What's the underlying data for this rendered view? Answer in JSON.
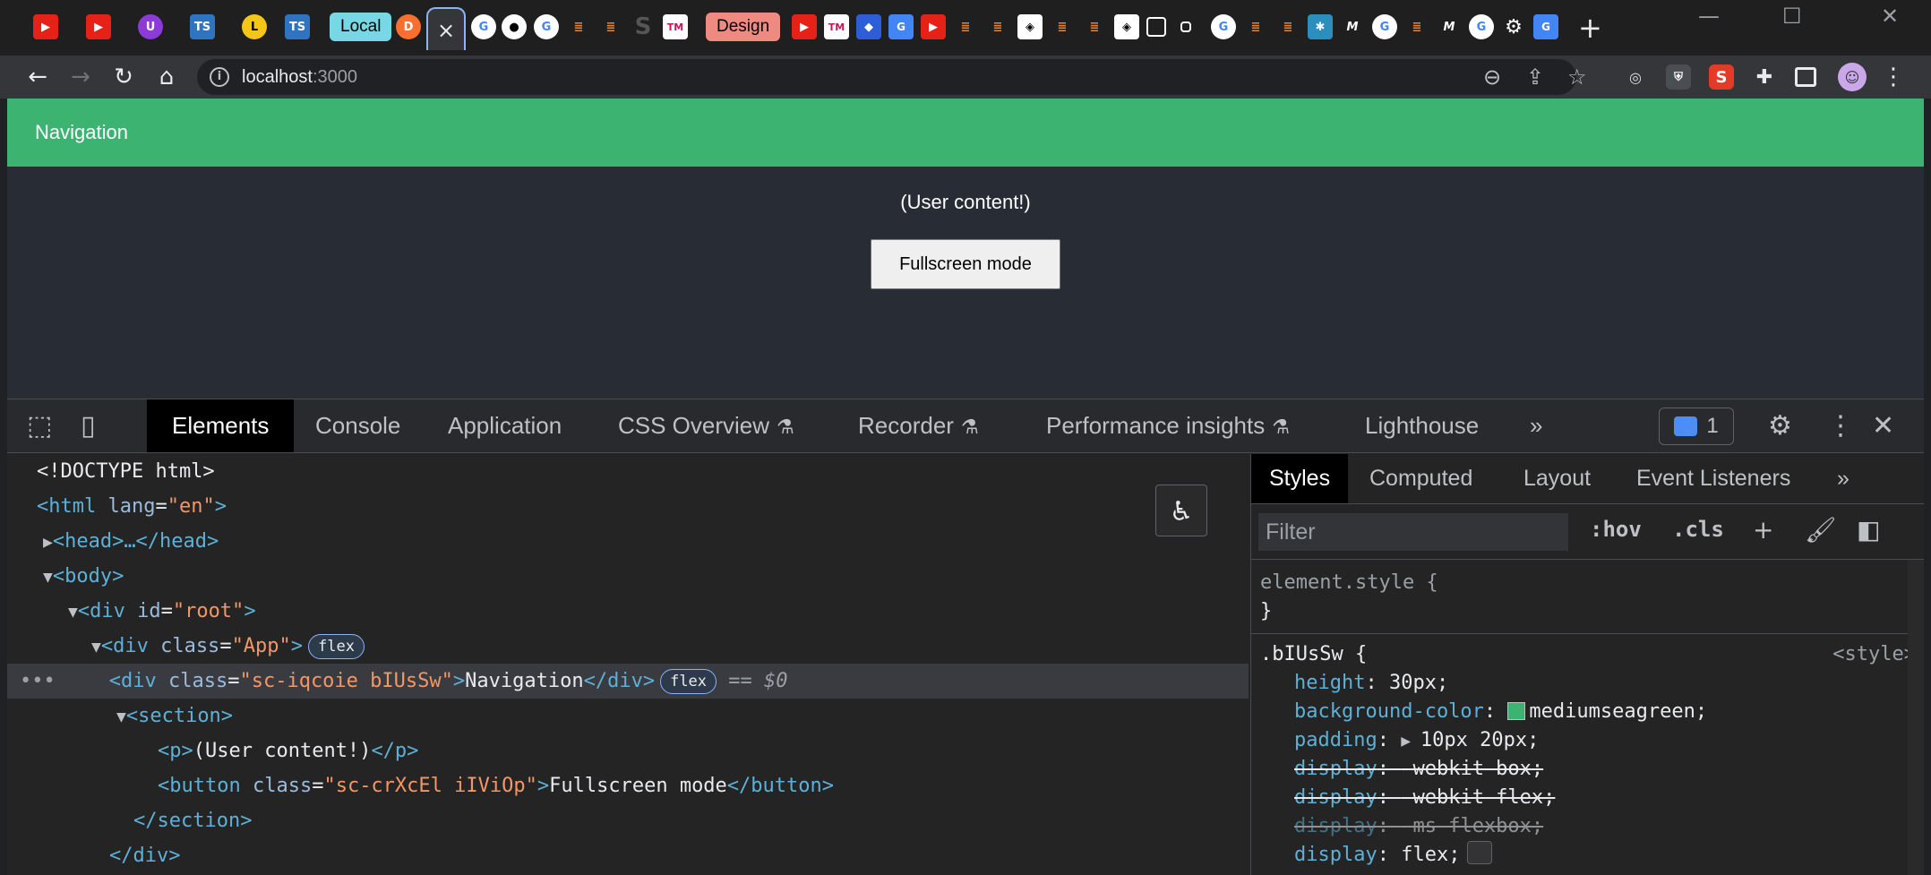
{
  "browser": {
    "tabs": [
      {
        "label": "Local",
        "bg": "#78d7e5"
      },
      {
        "label": "Design",
        "bg": "#ef8a80"
      }
    ],
    "active_tab_close": "×",
    "new_tab": "+",
    "window": {
      "minimize": "—",
      "maximize": "☐",
      "close": "✕"
    }
  },
  "toolbar": {
    "back": "←",
    "forward": "→",
    "reload": "↻",
    "home": "⌂",
    "url_host": "localhost",
    "url_port": ":3000",
    "zoom": "⊖",
    "share": "⇪",
    "star": "☆",
    "ext_s_label": "S",
    "menu": "⋮"
  },
  "page": {
    "nav_text": "Navigation",
    "user_content": "(User content!)",
    "button_label": "Fullscreen mode",
    "nav_color": "#3cb371"
  },
  "devtools": {
    "tabs": [
      "Elements",
      "Console",
      "Application",
      "CSS Overview",
      "Recorder",
      "Performance insights",
      "Lighthouse"
    ],
    "more": "»",
    "issues_count": "1",
    "dom": {
      "doctype": "<!DOCTYPE html>",
      "html_open": "<html",
      "html_attr": "lang",
      "html_val": "\"en\"",
      "html_close": ">",
      "head": "<head>…</head>",
      "body": "<body>",
      "root_open": "<div",
      "root_attr": "id",
      "root_val": "\"root\"",
      "app_open": "<div",
      "app_attr": "class",
      "app_val": "\"App\"",
      "flex_badge": "flex",
      "nav_open": "<div",
      "nav_attr": "class",
      "nav_val": "\"sc-iqcoie bIUsSw\"",
      "nav_text": "Navigation",
      "div_close": "</div>",
      "dollar": "== $0",
      "section_open": "<section>",
      "p_open": "<p>",
      "p_text": "(User content!)",
      "p_close": "</p>",
      "btn_open": "<button",
      "btn_attr": "class",
      "btn_val": "\"sc-crXcEl iIViOp\"",
      "btn_text": "Fullscreen mode",
      "btn_close": "</button>",
      "section_close": "</section>",
      "app_close": "</div>",
      "dots": "•••"
    },
    "styles": {
      "tabs": [
        "Styles",
        "Computed",
        "Layout",
        "Event Listeners"
      ],
      "filter_placeholder": "Filter",
      "hov": ":hov",
      "cls": ".cls",
      "element_style": "element.style {",
      "close_brace": "}",
      "rule_selector": ".bIUsSw {",
      "rule_source": "<style>",
      "props": [
        {
          "name": "height",
          "value": "30px;"
        },
        {
          "name": "background-color",
          "value": "mediumseagreen;"
        },
        {
          "name": "padding",
          "value": "10px 20px;"
        },
        {
          "name": "display",
          "value": "-webkit-box;"
        },
        {
          "name": "display",
          "value": "-webkit-flex;"
        },
        {
          "name": "display",
          "value": "-ms-flexbox;"
        },
        {
          "name": "display",
          "value": "flex;"
        }
      ]
    }
  }
}
